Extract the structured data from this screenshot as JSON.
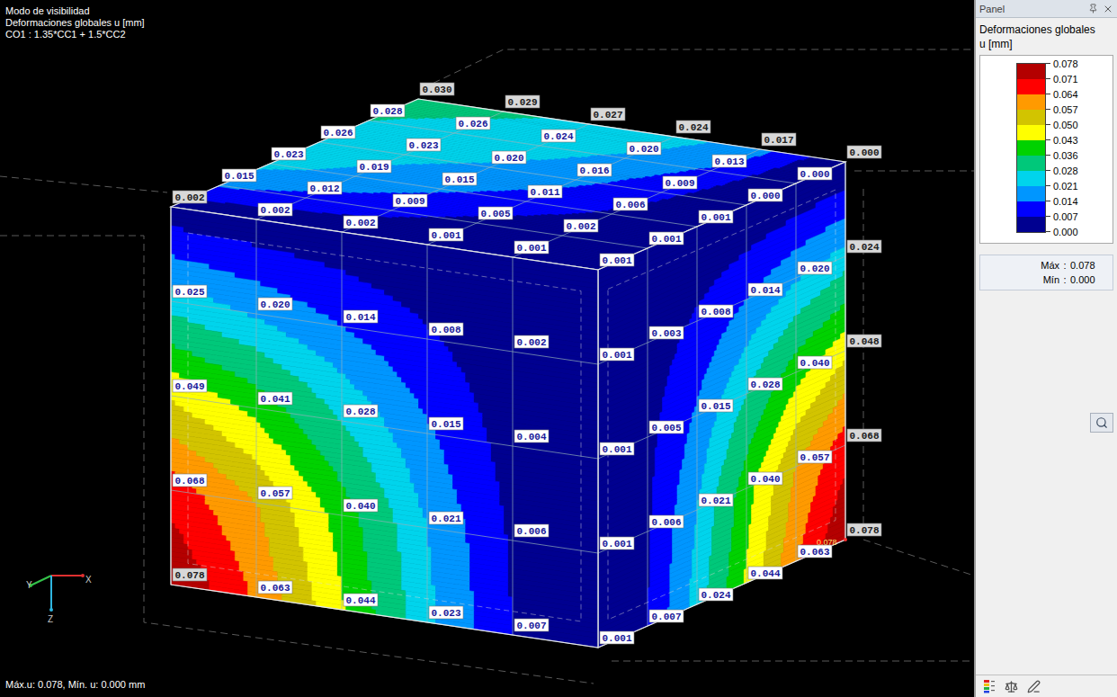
{
  "viewport": {
    "info_lines": [
      "Modo de visibilidad",
      "Deformaciones globales u [mm]",
      "CO1 : 1.35*CC1 + 1.5*CC2"
    ],
    "status": "Máx.u: 0.078, Mín. u: 0.000 mm",
    "axes": [
      {
        "label": "Y",
        "color": "#34c24a"
      },
      {
        "label": "X",
        "color": "#e03030"
      },
      {
        "label": "Z",
        "color": "#2fb6e0"
      }
    ],
    "model": {
      "faces": {
        "top": {
          "values": [
            [
              "0.002",
              "0.002",
              "0.002",
              "0.001",
              "0.001",
              "0.001"
            ],
            [
              "0.015",
              "0.012",
              "0.009",
              "0.005",
              "0.002",
              "0.001"
            ],
            [
              "0.023",
              "0.019",
              "0.015",
              "0.011",
              "0.006",
              "0.001"
            ],
            [
              "0.026",
              "0.023",
              "0.020",
              "0.016",
              "0.009",
              "0.000"
            ],
            [
              "0.028",
              "0.026",
              "0.024",
              "0.020",
              "0.013",
              "0.000"
            ],
            [
              "0.030",
              "0.029",
              "0.027",
              "0.024",
              "0.017",
              "0.000"
            ]
          ]
        },
        "right": {
          "values": [
            [
              "0.001",
              "0.001",
              "0.001",
              "0.000",
              "0.000",
              "0.000"
            ],
            [
              "0.001",
              "0.003",
              "0.008",
              "0.014",
              "0.020",
              "0.024"
            ],
            [
              "0.001",
              "0.005",
              "0.015",
              "0.028",
              "0.040",
              "0.048"
            ],
            [
              "0.001",
              "0.006",
              "0.021",
              "0.040",
              "0.057",
              "0.068"
            ],
            [
              "0.001",
              "0.007",
              "0.024",
              "0.044",
              "0.063",
              "0.078"
            ]
          ]
        },
        "front": {
          "values": [
            [
              "0.002",
              "0.002",
              "0.002",
              "0.001",
              "0.001",
              "0.001"
            ],
            [
              "0.025",
              "0.020",
              "0.014",
              "0.008",
              "0.002",
              "0.001"
            ],
            [
              "0.049",
              "0.041",
              "0.028",
              "0.015",
              "0.004",
              "0.001"
            ],
            [
              "0.068",
              "0.057",
              "0.040",
              "0.021",
              "0.006",
              "0.001"
            ],
            [
              "0.078",
              "0.063",
              "0.044",
              "0.023",
              "0.007",
              "0.001"
            ]
          ]
        }
      },
      "max_marker": "0.078"
    }
  },
  "panel": {
    "title": "Panel",
    "result_title": "Deformaciones globales",
    "unit": "u [mm]",
    "legend": {
      "ticks": [
        "0.078",
        "0.071",
        "0.064",
        "0.057",
        "0.050",
        "0.043",
        "0.036",
        "0.028",
        "0.021",
        "0.014",
        "0.007",
        "0.000"
      ],
      "bands": [
        {
          "color": "#b40000"
        },
        {
          "color": "#ff0000"
        },
        {
          "color": "#ff9a00"
        },
        {
          "color": "#d2c400"
        },
        {
          "color": "#ffff00"
        },
        {
          "color": "#00d200"
        },
        {
          "color": "#00c87a"
        },
        {
          "color": "#00d4ec"
        },
        {
          "color": "#0096ff"
        },
        {
          "color": "#0000ff"
        },
        {
          "color": "#000090"
        }
      ]
    },
    "summary": [
      {
        "label": "Máx",
        "separator": ":",
        "value": "0.078"
      },
      {
        "label": "Mín",
        "separator": ":",
        "value": "0.000"
      }
    ]
  }
}
